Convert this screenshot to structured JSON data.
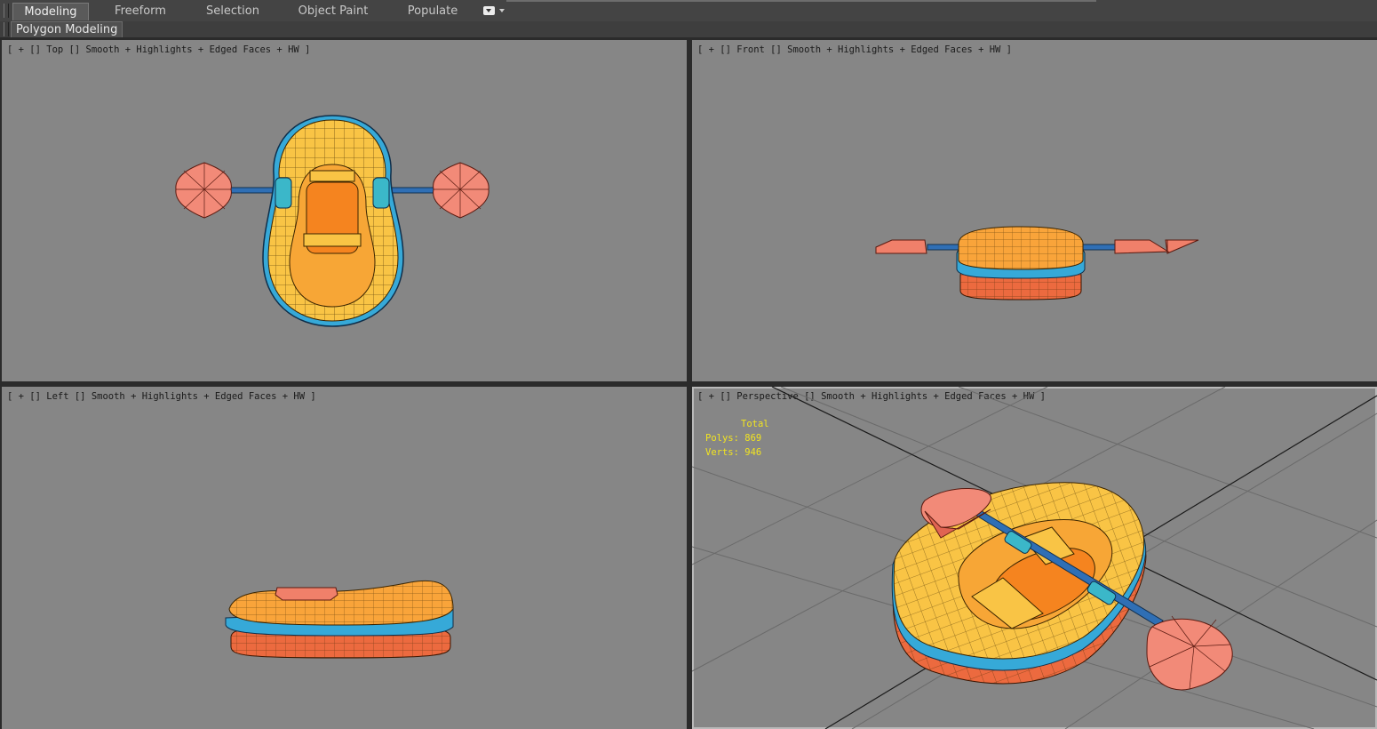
{
  "ribbon": {
    "tabs": [
      {
        "label": "Modeling",
        "active": true
      },
      {
        "label": "Freeform",
        "active": false
      },
      {
        "label": "Selection",
        "active": false
      },
      {
        "label": "Object Paint",
        "active": false
      },
      {
        "label": "Populate",
        "active": false
      }
    ]
  },
  "subbar": {
    "panel_label": "Polygon Modeling"
  },
  "viewports": {
    "top": {
      "label": "[ + [] Top [] Smooth + Highlights + Edged Faces + HW ]"
    },
    "front": {
      "label": "[ + [] Front [] Smooth + Highlights + Edged Faces + HW ]"
    },
    "left": {
      "label": "[ + [] Left [] Smooth + Highlights + Edged Faces + HW ]"
    },
    "perspective": {
      "label": "[ + [] Perspective [] Smooth + Highlights + Edged Faces + HW ]"
    }
  },
  "stats": {
    "total_label": "Total",
    "polys": "Polys: 869",
    "verts": "Verts: 946"
  },
  "colors": {
    "viewport_bg": "#868686",
    "raft_yellow": "#f9c445",
    "raft_orange": "#f5841f",
    "raft_blue": "#36a9d8",
    "paddle_salmon": "#f0806a",
    "stats_yellow": "#f2e420"
  }
}
